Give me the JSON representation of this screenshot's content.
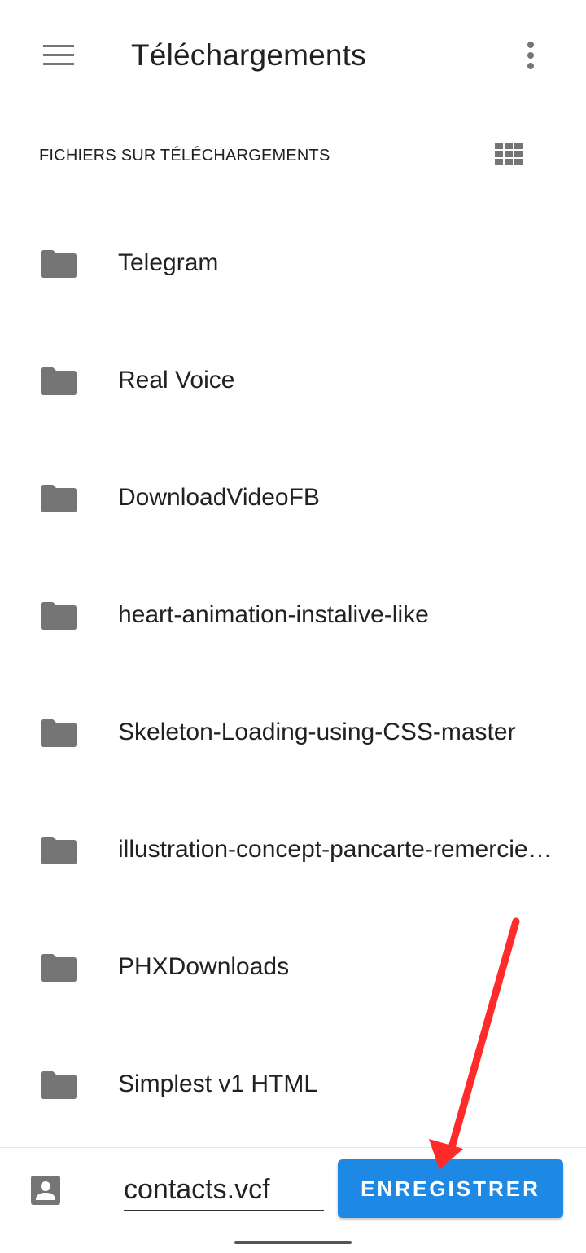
{
  "appbar": {
    "title": "Téléchargements",
    "menu_icon": "hamburger-menu-icon",
    "more_icon": "more-vert-icon"
  },
  "section": {
    "header": "FICHIERS SUR TÉLÉCHARGEMENTS",
    "grid_icon": "grid-view-icon"
  },
  "folders": [
    {
      "name": "Telegram"
    },
    {
      "name": "Real Voice"
    },
    {
      "name": "DownloadVideoFB"
    },
    {
      "name": "heart-animation-instalive-like"
    },
    {
      "name": "Skeleton-Loading-using-CSS-master"
    },
    {
      "name": "illustration-concept-pancarte-remerciement"
    },
    {
      "name": "PHXDownloads"
    },
    {
      "name": "Simplest v1 HTML"
    }
  ],
  "bottom": {
    "filename": "contacts.vcf",
    "save_label": "ENREGISTRER",
    "contact_icon": "contact-card-icon"
  },
  "colors": {
    "accent": "#1e88e5",
    "icon": "#757575",
    "annotation_arrow": "#ff2a2a"
  }
}
